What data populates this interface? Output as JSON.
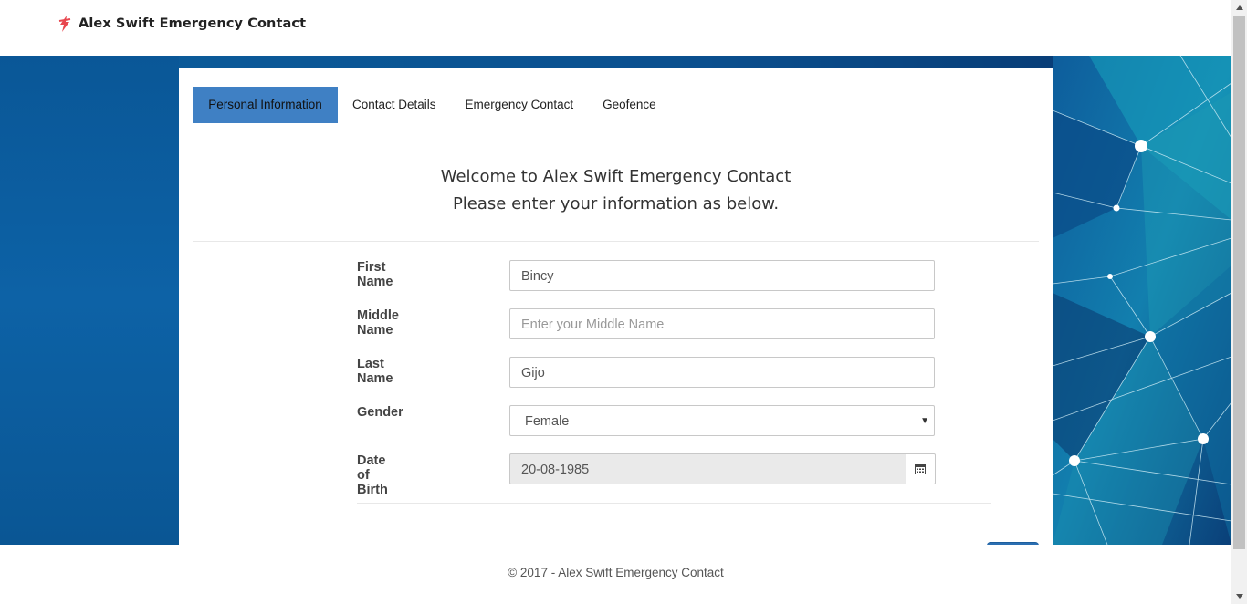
{
  "app": {
    "brand_title": "Alex Swift Emergency Contact"
  },
  "tabs": [
    {
      "label": "Personal Information",
      "active": true
    },
    {
      "label": "Contact Details",
      "active": false
    },
    {
      "label": "Emergency Contact",
      "active": false
    },
    {
      "label": "Geofence",
      "active": false
    }
  ],
  "welcome": {
    "line1": "Welcome to Alex Swift Emergency Contact",
    "line2": "Please enter your information as below."
  },
  "form": {
    "first_name": {
      "label": "First Name",
      "value": "Bincy",
      "placeholder": ""
    },
    "middle_name": {
      "label": "Middle Name",
      "value": "",
      "placeholder": "Enter your Middle Name"
    },
    "last_name": {
      "label": "Last Name",
      "value": "Gijo",
      "placeholder": ""
    },
    "gender": {
      "label": "Gender",
      "value": "Female"
    },
    "dob": {
      "label": "Date of Birth",
      "value": "20-08-1985"
    }
  },
  "footer": {
    "text": "© 2017 - Alex Swift Emergency Contact"
  },
  "colors": {
    "accent": "#3f80c4",
    "band": "#0b5a99",
    "brand_logo": "#e8474f"
  },
  "icons": {
    "brand": "flash-logo-icon",
    "calendar": "calendar-icon",
    "select": "caret-down-icon"
  }
}
